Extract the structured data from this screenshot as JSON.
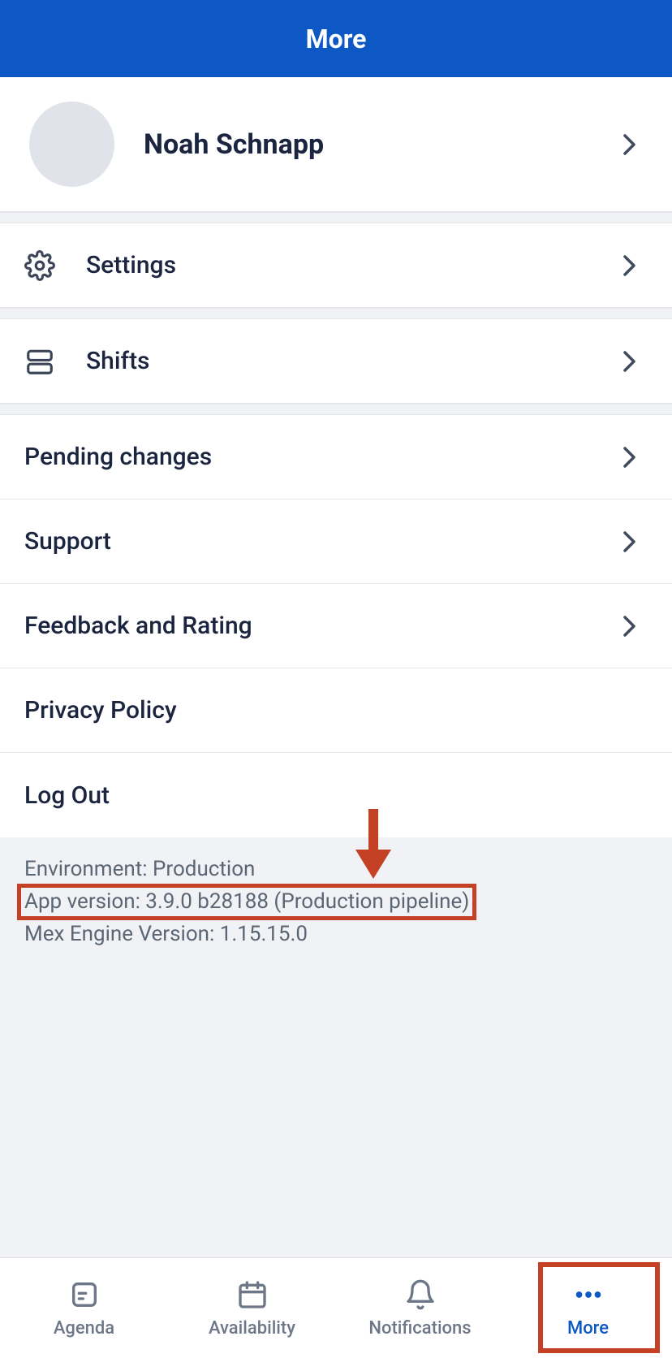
{
  "header": {
    "title": "More"
  },
  "profile": {
    "name": "Noah Schnapp"
  },
  "menu": {
    "settings": "Settings",
    "shifts": "Shifts",
    "pending_changes": "Pending changes",
    "support": "Support",
    "feedback": "Feedback and Rating",
    "privacy": "Privacy Policy",
    "logout": "Log Out"
  },
  "footer": {
    "environment": "Environment: Production",
    "app_version": "App version: 3.9.0 b28188 (Production pipeline)",
    "mex_engine": "Mex Engine Version: 1.15.15.0"
  },
  "tabs": {
    "agenda": "Agenda",
    "availability": "Availability",
    "notifications": "Notifications",
    "more": "More"
  },
  "annotations": {
    "highlight_color": "#c54125",
    "arrow_points_to": "app_version"
  }
}
